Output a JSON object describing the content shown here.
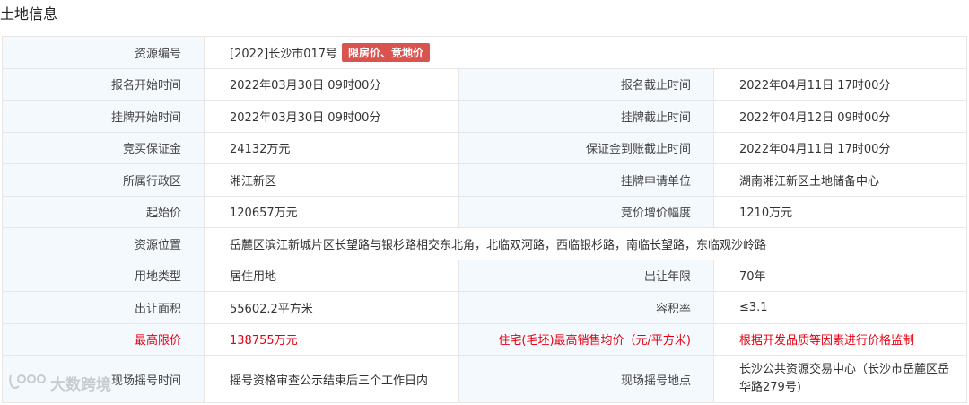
{
  "section_title": "土地信息",
  "resource_no": {
    "label": "资源编号",
    "value": "[2022]长沙市017号",
    "badge": "限房价、竞地价"
  },
  "rows": [
    {
      "l1": "报名开始时间",
      "v1": "2022年03月30日 09时00分",
      "l2": "报名截止时间",
      "v2": "2022年04月11日 17时00分"
    },
    {
      "l1": "挂牌开始时间",
      "v1": "2022年03月30日 09时00分",
      "l2": "挂牌截止时间",
      "v2": "2022年04月12日 09时00分"
    },
    {
      "l1": "竞买保证金",
      "v1": "24132万元",
      "l2": "保证金到账截止时间",
      "v2": "2022年04月11日 17时00分"
    },
    {
      "l1": "所属行政区",
      "v1": "湘江新区",
      "l2": "挂牌申请单位",
      "v2": "湖南湘江新区土地储备中心"
    },
    {
      "l1": "起始价",
      "v1": "120657万元",
      "l2": "竞价增价幅度",
      "v2": "1210万元"
    }
  ],
  "location": {
    "label": "资源位置",
    "value": "岳麓区滨江新城片区长望路与银杉路相交东北角，北临双河路，西临银杉路，南临长望路，东临观沙岭路"
  },
  "rows2": [
    {
      "l1": "用地类型",
      "v1": "居住用地",
      "l2": "出让年限",
      "v2": "70年"
    },
    {
      "l1": "出让面积",
      "v1": "55602.2平方米",
      "l2": "容积率",
      "v2": "≤3.1"
    }
  ],
  "price_limit": {
    "l1": "最高限价",
    "v1": "138755万元",
    "l2": "住宅(毛坯)最高销售均价（元/平方米)",
    "v2": "根据开发品质等因素进行价格监制"
  },
  "lottery": {
    "l1": "现场摇号时间",
    "v1": "摇号资格审查公示结束后三个工作日内",
    "l2": "现场摇号地点",
    "v2": "长沙公共资源交易中心（长沙市岳麓区岳华路279号)"
  },
  "watermark": {
    "text": "大数跨境",
    "icon": "brand-logo-icon"
  },
  "colors": {
    "label_bg": "#f4f9fd",
    "border": "#e6e6e6",
    "red": "#e60012",
    "badge": "#d9534f"
  }
}
